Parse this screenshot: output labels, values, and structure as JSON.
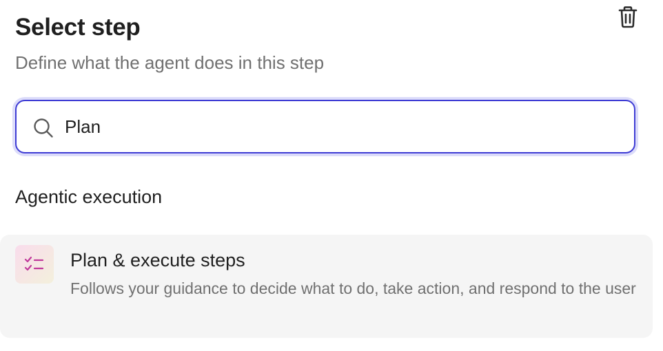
{
  "header": {
    "title": "Select step",
    "subtitle": "Define what the agent does in this step"
  },
  "search": {
    "value": "Plan",
    "placeholder": ""
  },
  "sections": [
    {
      "heading": "Agentic execution",
      "options": [
        {
          "title": "Plan & execute steps",
          "description": "Follows your guidance to decide what to do, take action, and respond to the user",
          "icon": "checklist-icon"
        }
      ]
    }
  ],
  "icons": {
    "delete": "trash-icon",
    "search": "search-icon"
  },
  "colors": {
    "focus_border": "#3d3bd4",
    "focus_ring": "#dcdcfa",
    "icon_accent": "#c0389a",
    "option_bg": "#f5f5f5"
  }
}
